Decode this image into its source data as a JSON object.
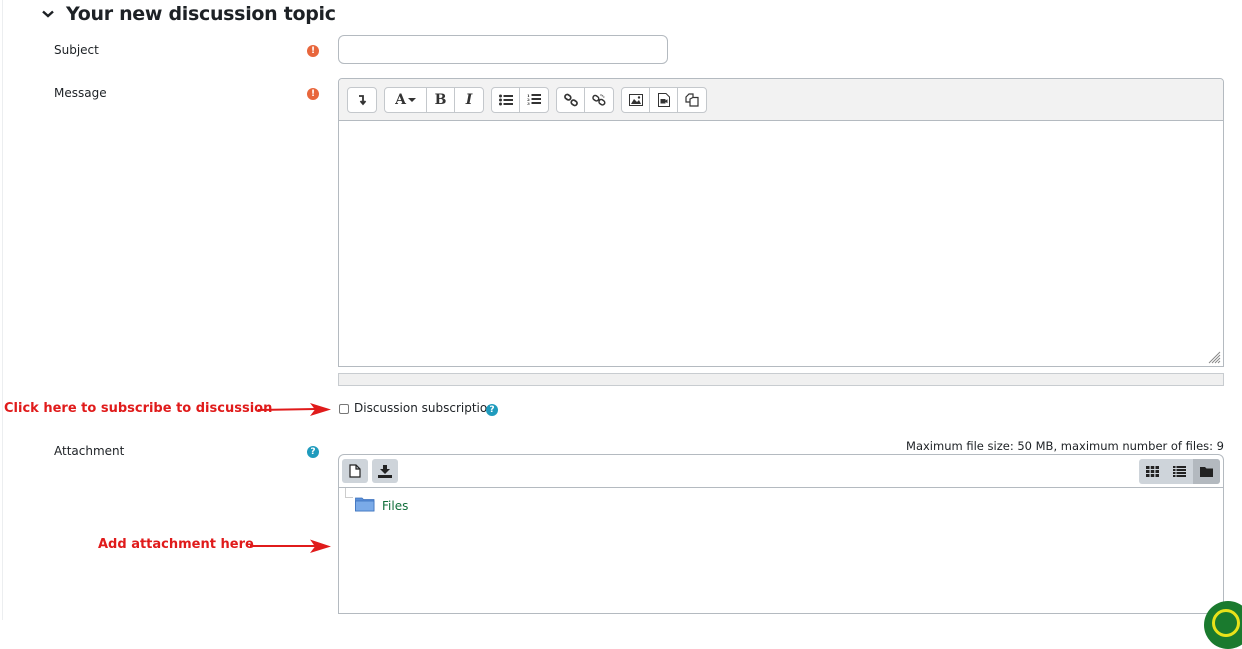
{
  "section": {
    "title": "Your new discussion topic",
    "collapse_icon": "chevron-down-icon"
  },
  "fields": {
    "subject": {
      "label": "Subject",
      "value": "",
      "placeholder": "",
      "required_icon": "exclamation-circle-icon"
    },
    "message": {
      "label": "Message",
      "required_icon": "exclamation-circle-icon"
    },
    "subscription": {
      "label": "Discussion subscription",
      "checked": false,
      "help_icon": "question-circle-icon"
    },
    "attachment": {
      "label": "Attachment",
      "help_icon": "question-circle-icon"
    }
  },
  "editor": {
    "toolbar_groups": [
      [
        "toolbar-toggle-icon"
      ],
      [
        "font-style-icon",
        "bold-icon",
        "italic-icon"
      ],
      [
        "unordered-list-icon",
        "ordered-list-icon"
      ],
      [
        "link-icon",
        "unlink-icon"
      ],
      [
        "image-icon",
        "media-icon",
        "manage-files-icon"
      ]
    ],
    "labels": {
      "font": "A",
      "bold": "B",
      "italic": "I"
    },
    "content": ""
  },
  "filepicker": {
    "max_info": "Maximum file size: 50 MB, maximum number of files: 9",
    "buttons": [
      "add-file-icon",
      "download-icon"
    ],
    "views": [
      {
        "icon": "grid-view-icon",
        "active": false
      },
      {
        "icon": "list-view-icon",
        "active": false
      },
      {
        "icon": "tree-view-icon",
        "active": true
      }
    ],
    "folder_label": "Files"
  },
  "annotations": {
    "subscribe": "Click here to subscribe to discussion",
    "attachment": "Add attachment here",
    "color": "#e01b1b"
  },
  "colors": {
    "required": "#e8663c",
    "help": "#1f9bbd",
    "folder_link": "#0f6e3a"
  }
}
